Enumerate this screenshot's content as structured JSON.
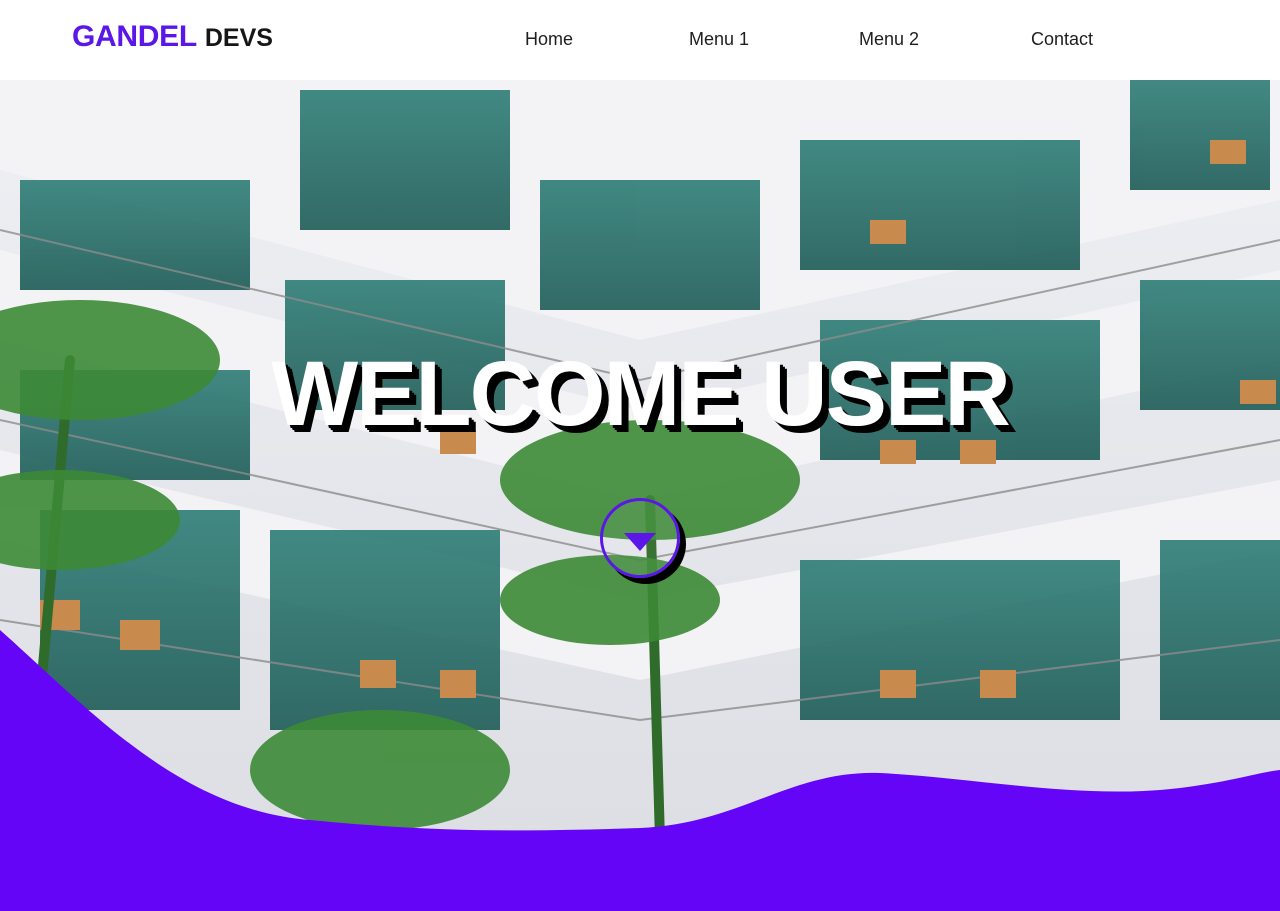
{
  "brand": {
    "primary": "GANDEL",
    "secondary": "DEVS"
  },
  "nav": {
    "home": "Home",
    "menu1": "Menu 1",
    "menu2": "Menu 2",
    "contact": "Contact"
  },
  "hero": {
    "title": "WELCOME USER",
    "scroll_icon": "chevron-down-circle-icon"
  },
  "colors": {
    "accent": "#5b16e8",
    "text": "#1e1e1e",
    "background": "#ffffff"
  }
}
